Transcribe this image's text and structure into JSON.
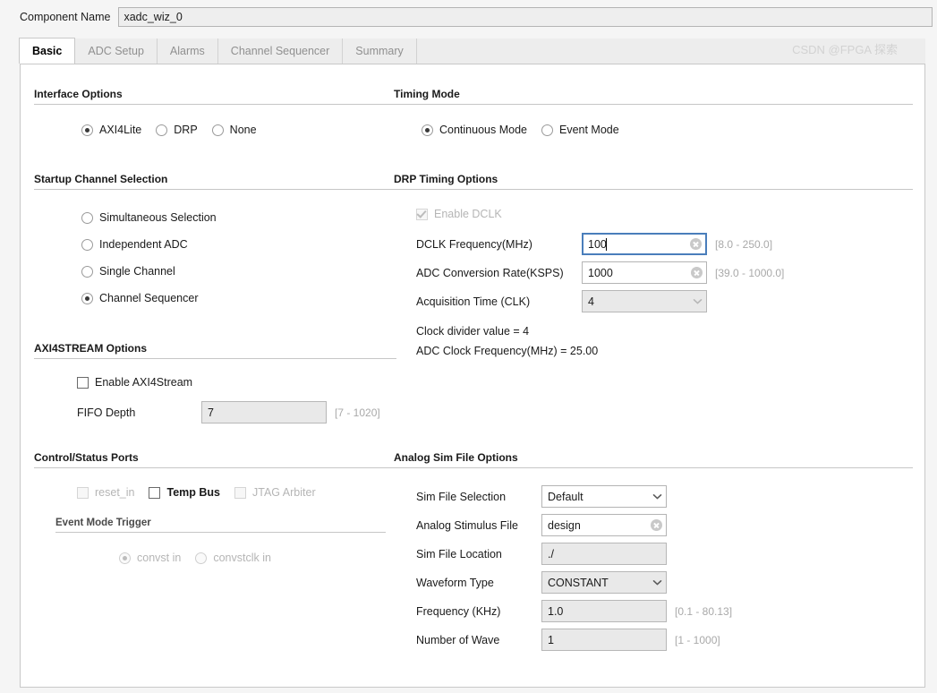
{
  "window": {
    "component_name_label": "Component Name",
    "component_name_value": "xadc_wiz_0",
    "watermark": "CSDN @FPGA 探索"
  },
  "tabs": [
    {
      "label": "Basic",
      "active": true
    },
    {
      "label": "ADC Setup",
      "active": false
    },
    {
      "label": "Alarms",
      "active": false
    },
    {
      "label": "Channel Sequencer",
      "active": false
    },
    {
      "label": "Summary",
      "active": false
    }
  ],
  "left": {
    "interface_options": {
      "title": "Interface Options",
      "radios": [
        {
          "label": "AXI4Lite",
          "selected": true,
          "disabled": false
        },
        {
          "label": "DRP",
          "selected": false,
          "disabled": false
        },
        {
          "label": "None",
          "selected": false,
          "disabled": false
        }
      ]
    },
    "startup_channel_selection": {
      "title": "Startup Channel Selection",
      "radios": [
        {
          "label": "Simultaneous Selection",
          "selected": false,
          "disabled": false
        },
        {
          "label": "Independent ADC",
          "selected": false,
          "disabled": false
        },
        {
          "label": "Single Channel",
          "selected": false,
          "disabled": false
        },
        {
          "label": "Channel Sequencer",
          "selected": true,
          "disabled": false
        }
      ]
    },
    "axi4stream_options": {
      "title": "AXI4STREAM Options",
      "enable_label": "Enable AXI4Stream",
      "enable_checked": false,
      "fifo_depth_label": "FIFO Depth",
      "fifo_depth_value": "7",
      "fifo_depth_hint": "[7 - 1020]"
    },
    "control_status_ports": {
      "title": "Control/Status Ports",
      "checkboxes": [
        {
          "label": "reset_in",
          "checked": false,
          "disabled": true
        },
        {
          "label": "Temp Bus",
          "checked": false,
          "disabled": false
        },
        {
          "label": "JTAG Arbiter",
          "checked": false,
          "disabled": true
        }
      ],
      "event_mode_trigger": {
        "title": "Event Mode Trigger",
        "radios": [
          {
            "label": "convst in",
            "selected": true,
            "disabled": true
          },
          {
            "label": "convstclk in",
            "selected": false,
            "disabled": true
          }
        ]
      }
    }
  },
  "right": {
    "timing_mode": {
      "title": "Timing Mode",
      "radios": [
        {
          "label": "Continuous Mode",
          "selected": true,
          "disabled": false
        },
        {
          "label": "Event Mode",
          "selected": false,
          "disabled": false
        }
      ]
    },
    "drp_timing_options": {
      "title": "DRP Timing Options",
      "enable_dclk_label": "Enable DCLK",
      "enable_dclk_checked": true,
      "enable_dclk_disabled": true,
      "dclk_frequency_label": "DCLK Frequency(MHz)",
      "dclk_frequency_value": "100",
      "dclk_frequency_hint": "[8.0 - 250.0]",
      "adc_conversion_rate_label": "ADC Conversion Rate(KSPS)",
      "adc_conversion_rate_value": "1000",
      "adc_conversion_rate_hint": "[39.0 - 1000.0]",
      "acquisition_time_label": "Acquisition Time (CLK)",
      "acquisition_time_value": "4",
      "clock_divider_note": "Clock divider value = 4",
      "adc_clock_freq_note": "ADC Clock Frequency(MHz) = 25.00"
    },
    "analog_sim_file_options": {
      "title": "Analog Sim File Options",
      "sim_file_selection_label": "Sim File Selection",
      "sim_file_selection_value": "Default",
      "analog_stimulus_file_label": "Analog Stimulus File",
      "analog_stimulus_file_value": "design",
      "sim_file_location_label": "Sim File Location",
      "sim_file_location_value": "./",
      "waveform_type_label": "Waveform Type",
      "waveform_type_value": "CONSTANT",
      "frequency_label": "Frequency (KHz)",
      "frequency_value": "1.0",
      "frequency_hint": "[0.1 - 80.13]",
      "number_of_wave_label": "Number of Wave",
      "number_of_wave_value": "1",
      "number_of_wave_hint": "[1 - 1000]"
    }
  }
}
